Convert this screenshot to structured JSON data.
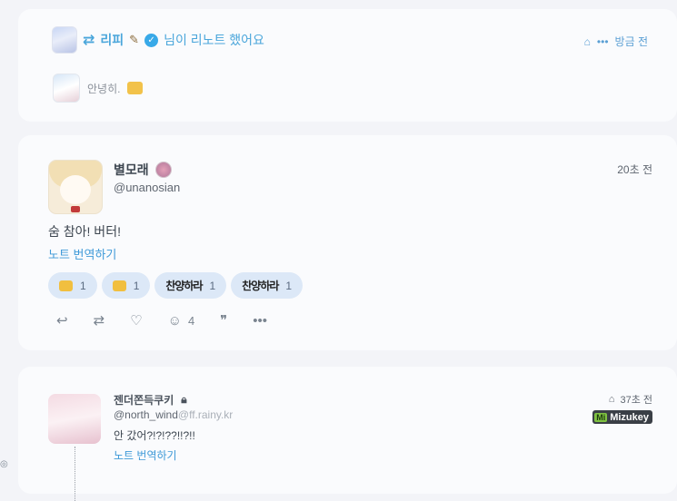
{
  "renote": {
    "icon": "repeat-icon",
    "user_name": "리피",
    "emoji_name": "broken-heart-emoji",
    "verified_icon": "verified-badge-icon",
    "action_text": "님이 리노트 했어요",
    "visibility_icon": "home-icon",
    "more_icon": "more-horizontal-icon",
    "time": "방금 전",
    "quote_text": "안녕히."
  },
  "note": {
    "display_name": "별모래",
    "handle": "@unanosian",
    "time": "20초 전",
    "text": "숨 참아! 버터!",
    "translate_label": "노트 번역하기",
    "reactions": [
      {
        "emoji": "butter-emoji",
        "count": "1"
      },
      {
        "emoji": "butter-emoji",
        "count": "1"
      },
      {
        "emoji_text": "찬양하라",
        "count": "1"
      },
      {
        "emoji_text": "찬양하라",
        "count": "1"
      }
    ],
    "actions": {
      "reply_icon": "reply-icon",
      "renote_icon": "repeat-icon",
      "like_icon": "heart-icon",
      "react_icon": "emoji-add-icon",
      "react_count": "4",
      "quote_icon": "quote-icon",
      "more_icon": "more-horizontal-icon"
    }
  },
  "note2": {
    "display_name": "젠더쫀득쿠키",
    "lock_icon": "lock-icon",
    "handle": "@north_wind",
    "host": "@ff.rainy.kr",
    "time": "37초 전",
    "instance_badge_prefix": "Mi",
    "instance_name": "Mizukey",
    "text": "안 갔어?!?!??!!?!!",
    "translate_label": "노트 번역하기"
  },
  "colors": {
    "accent": "#3f9ad8",
    "background": "#f3f4f8",
    "card": "#fafbfd",
    "reaction_bg": "#dce8f7"
  }
}
